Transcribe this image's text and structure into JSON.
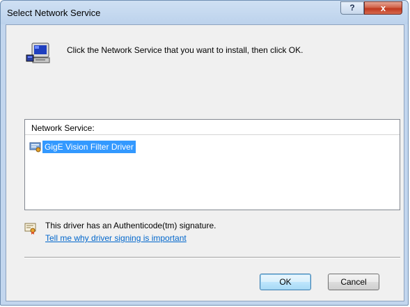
{
  "window": {
    "title": "Select Network Service",
    "help_label": "?",
    "close_label": "x"
  },
  "dialog": {
    "instruction": "Click the Network Service that you want to install, then click OK.",
    "list": {
      "header": "Network Service:",
      "items": [
        {
          "label": "GigE Vision Filter Driver",
          "selected": true,
          "icon": "network-service-icon"
        }
      ]
    },
    "signature": {
      "icon": "certificate-icon",
      "text": "This driver has an Authenticode(tm) signature.",
      "link": "Tell me why driver signing is important"
    },
    "buttons": {
      "ok": "OK",
      "cancel": "Cancel"
    }
  },
  "colors": {
    "selection": "#3399ff",
    "link": "#0066cc",
    "close_button": "#c0391f"
  }
}
